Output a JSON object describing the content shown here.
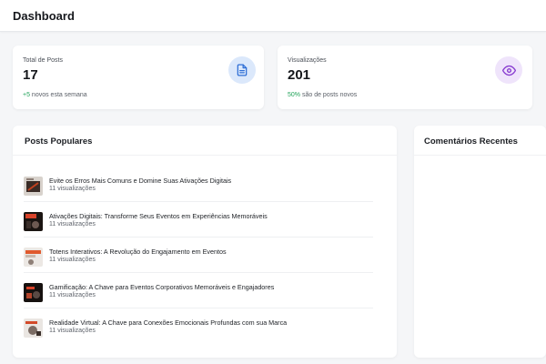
{
  "header": {
    "title": "Dashboard"
  },
  "stats": [
    {
      "label": "Total de Posts",
      "value": "17",
      "sub_highlight": "+5",
      "sub_text": " novos esta semana",
      "icon": "document-icon",
      "accent": "#2f6fd6"
    },
    {
      "label": "Visualizações",
      "value": "201",
      "sub_highlight": "50%",
      "sub_text": " são de posts novos",
      "icon": "eye-icon",
      "accent": "#8a3fd1"
    }
  ],
  "popular_posts": {
    "title": "Posts Populares",
    "items": [
      {
        "title": "Evite os Erros Mais Comuns e Domine Suas Ativações Digitais",
        "views": "11 visualizações"
      },
      {
        "title": "Ativações Digitais: Transforme Seus Eventos em Experiências Memoráveis",
        "views": "11 visualizações"
      },
      {
        "title": "Totens Interativos: A Revolução do Engajamento em Eventos",
        "views": "11 visualizações"
      },
      {
        "title": "Gamificação: A Chave para Eventos Corporativos Memoráveis e Engajadores",
        "views": "11 visualizações"
      },
      {
        "title": "Realidade Virtual: A Chave para Conexões Emocionais Profundas com sua Marca",
        "views": "11 visualizações"
      }
    ]
  },
  "recent_comments": {
    "title": "Comentários Recentes"
  },
  "colors": {
    "positive": "#22a35a",
    "card_bg": "#ffffff",
    "page_bg": "#f5f6f8"
  }
}
